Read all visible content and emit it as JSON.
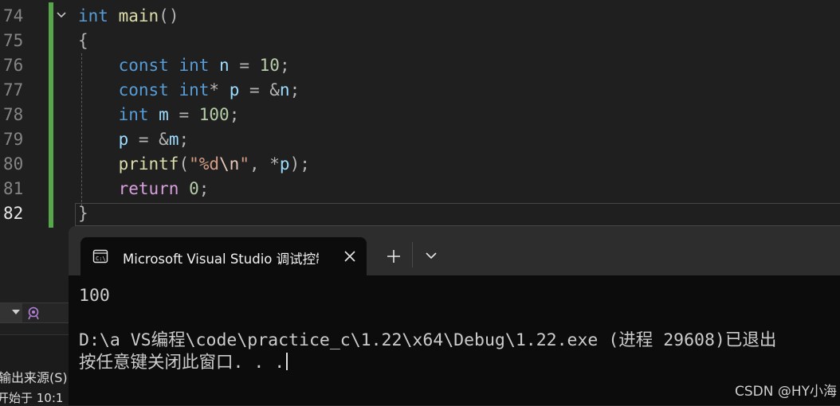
{
  "editor": {
    "line_numbers": [
      "74",
      "75",
      "76",
      "77",
      "78",
      "79",
      "80",
      "81",
      "82"
    ],
    "lines": [
      [
        {
          "t": "int",
          "c": "kw"
        },
        {
          "t": " "
        },
        {
          "t": "main",
          "c": "fn"
        },
        {
          "t": "()",
          "c": "pun"
        }
      ],
      [
        {
          "t": "{",
          "c": "pun"
        }
      ],
      [
        {
          "t": "    "
        },
        {
          "t": "const",
          "c": "kw"
        },
        {
          "t": " "
        },
        {
          "t": "int",
          "c": "kw"
        },
        {
          "t": " "
        },
        {
          "t": "n",
          "c": "id"
        },
        {
          "t": " = ",
          "c": "pun"
        },
        {
          "t": "10",
          "c": "num"
        },
        {
          "t": ";",
          "c": "pun"
        }
      ],
      [
        {
          "t": "    "
        },
        {
          "t": "const",
          "c": "kw"
        },
        {
          "t": " "
        },
        {
          "t": "int",
          "c": "kw"
        },
        {
          "t": "* ",
          "c": "pun"
        },
        {
          "t": "p",
          "c": "id"
        },
        {
          "t": " = &",
          "c": "pun"
        },
        {
          "t": "n",
          "c": "id"
        },
        {
          "t": ";",
          "c": "pun"
        }
      ],
      [
        {
          "t": "    "
        },
        {
          "t": "int",
          "c": "kw"
        },
        {
          "t": " "
        },
        {
          "t": "m",
          "c": "id"
        },
        {
          "t": " = ",
          "c": "pun"
        },
        {
          "t": "100",
          "c": "num"
        },
        {
          "t": ";",
          "c": "pun"
        }
      ],
      [
        {
          "t": "    "
        },
        {
          "t": "p",
          "c": "id"
        },
        {
          "t": " = &",
          "c": "pun"
        },
        {
          "t": "m",
          "c": "id"
        },
        {
          "t": ";",
          "c": "pun"
        }
      ],
      [
        {
          "t": "    "
        },
        {
          "t": "printf",
          "c": "fn"
        },
        {
          "t": "(",
          "c": "pun"
        },
        {
          "t": "\"%d",
          "c": "str"
        },
        {
          "t": "\\n",
          "c": "esc"
        },
        {
          "t": "\"",
          "c": "str"
        },
        {
          "t": ", *",
          "c": "pun"
        },
        {
          "t": "p",
          "c": "id"
        },
        {
          "t": ");",
          "c": "pun"
        }
      ],
      [
        {
          "t": "    "
        },
        {
          "t": "return",
          "c": "ctl"
        },
        {
          "t": " "
        },
        {
          "t": "0",
          "c": "num"
        },
        {
          "t": ";",
          "c": "pun"
        }
      ],
      [
        {
          "t": "}",
          "c": "pun"
        }
      ]
    ],
    "active_line": "82",
    "colors": {
      "change_bar": "#57a64a",
      "keyword": "#569cd6",
      "function": "#dcdcaa",
      "number": "#b5cea8",
      "string": "#d69d85",
      "control": "#d8a0df"
    }
  },
  "left_panel": {
    "source_label": "输出来源(S):",
    "start_label": "开始于  10:1"
  },
  "terminal": {
    "tab_title": "Microsoft Visual Studio 调试控制台",
    "output_value": "100",
    "exit_message": "D:\\a VS编程\\code\\practice_c\\1.22\\x64\\Debug\\1.22.exe (进程 29608)已退出",
    "prompt": "按任意键关闭此窗口. . ."
  },
  "watermark": "CSDN @HY小海"
}
